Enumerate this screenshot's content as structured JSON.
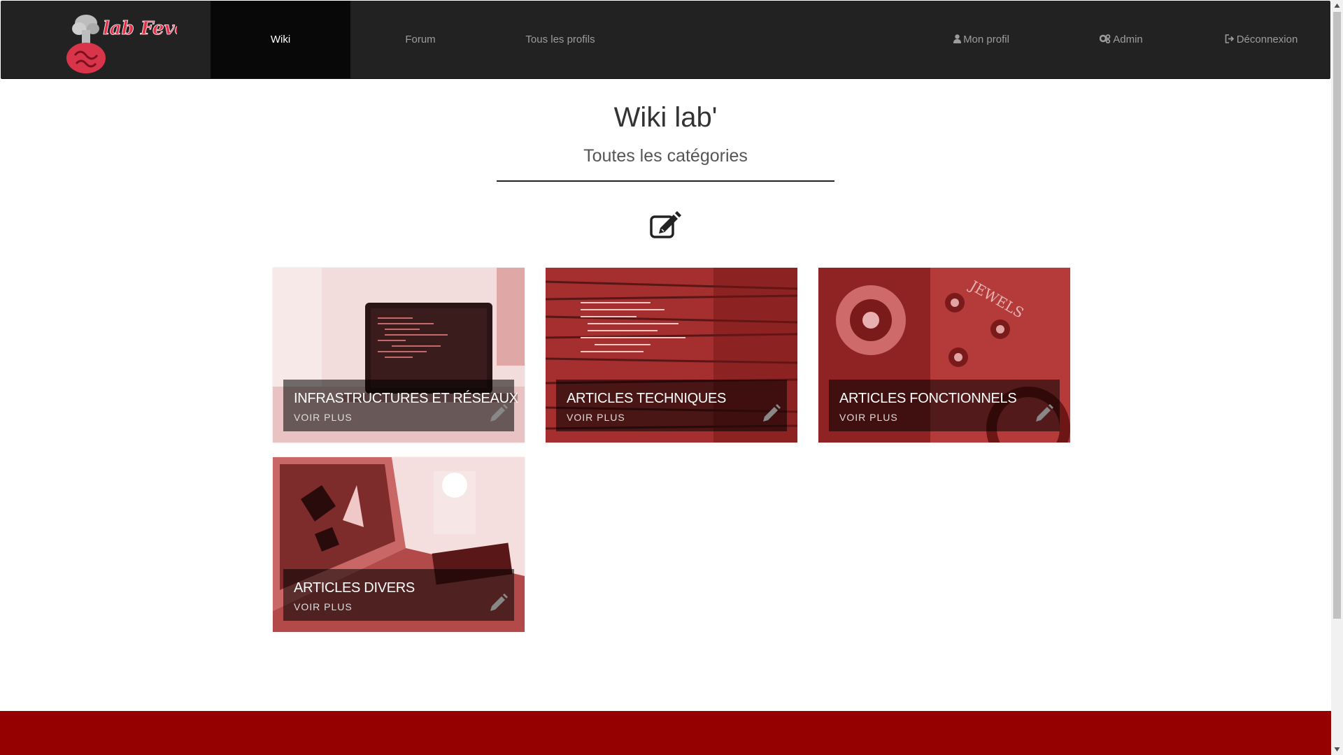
{
  "navbar": {
    "logo_text": "lab Fever",
    "items": [
      {
        "label": "Wiki",
        "active": true
      },
      {
        "label": "Forum"
      },
      {
        "label": "Tous les profils"
      }
    ],
    "right": [
      {
        "label": "Mon profil",
        "icon": "user-icon"
      },
      {
        "label": "Admin",
        "icon": "gears-icon"
      },
      {
        "label": "Déconnexion",
        "icon": "sign-out-icon"
      }
    ]
  },
  "header": {
    "title": "Wiki lab'",
    "subtitle": "Toutes les catégories"
  },
  "actions": {
    "edit_icon": "edit-icon"
  },
  "categories": [
    {
      "title": "INFRASTRUCTURES ET RÉSEAUX",
      "link": "VOIR PLUS"
    },
    {
      "title": "ARTICLES TECHNIQUES",
      "link": "VOIR PLUS"
    },
    {
      "title": "ARTICLES FONCTIONNELS",
      "link": "VOIR PLUS"
    },
    {
      "title": "ARTICLES DIVERS",
      "link": "VOIR PLUS"
    }
  ],
  "colors": {
    "navbar_bg": "#222222",
    "navbar_active": "#080808",
    "accent": "#950000",
    "card_tint": "#c0393b"
  }
}
